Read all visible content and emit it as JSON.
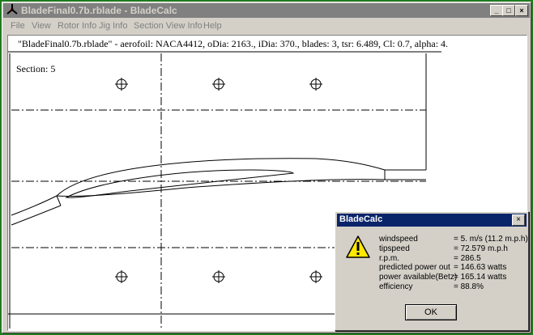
{
  "window": {
    "title": "BladeFinal0.7b.rblade - BladeCalc",
    "buttons": {
      "minimize": "_",
      "maximize": "□",
      "close": "×"
    }
  },
  "menu": {
    "items": [
      {
        "label": "File"
      },
      {
        "label": "View"
      },
      {
        "label": "Rotor Info"
      },
      {
        "label": "Jig Info"
      },
      {
        "label": "Section View Info"
      },
      {
        "label": "Help"
      }
    ]
  },
  "canvas": {
    "info_line": "\"BladeFinal0.7b.rblade\" - aerofoil: NACA4412, oDia: 2163., iDia: 370., blades: 3, tsr: 6.489, Cl: 0.7, alpha: 4.",
    "section_label": "Section: 5"
  },
  "dialog": {
    "title": "BladeCalc",
    "close_glyph": "×",
    "icon": "warning-icon",
    "stats": [
      {
        "label": "windspeed",
        "value": "= 5. m/s (11.2 m.p.h)"
      },
      {
        "label": "tipspeed",
        "value": "= 72.579 m.p.h"
      },
      {
        "label": "r.p.m.",
        "value": "= 286.5"
      },
      {
        "label": "predicted power out",
        "value": "= 146.63 watts"
      },
      {
        "label": "power available(Betz)",
        "value": "= 165.14 watts"
      },
      {
        "label": "efficiency",
        "value": "= 88.8%"
      }
    ],
    "ok_label": "OK"
  }
}
